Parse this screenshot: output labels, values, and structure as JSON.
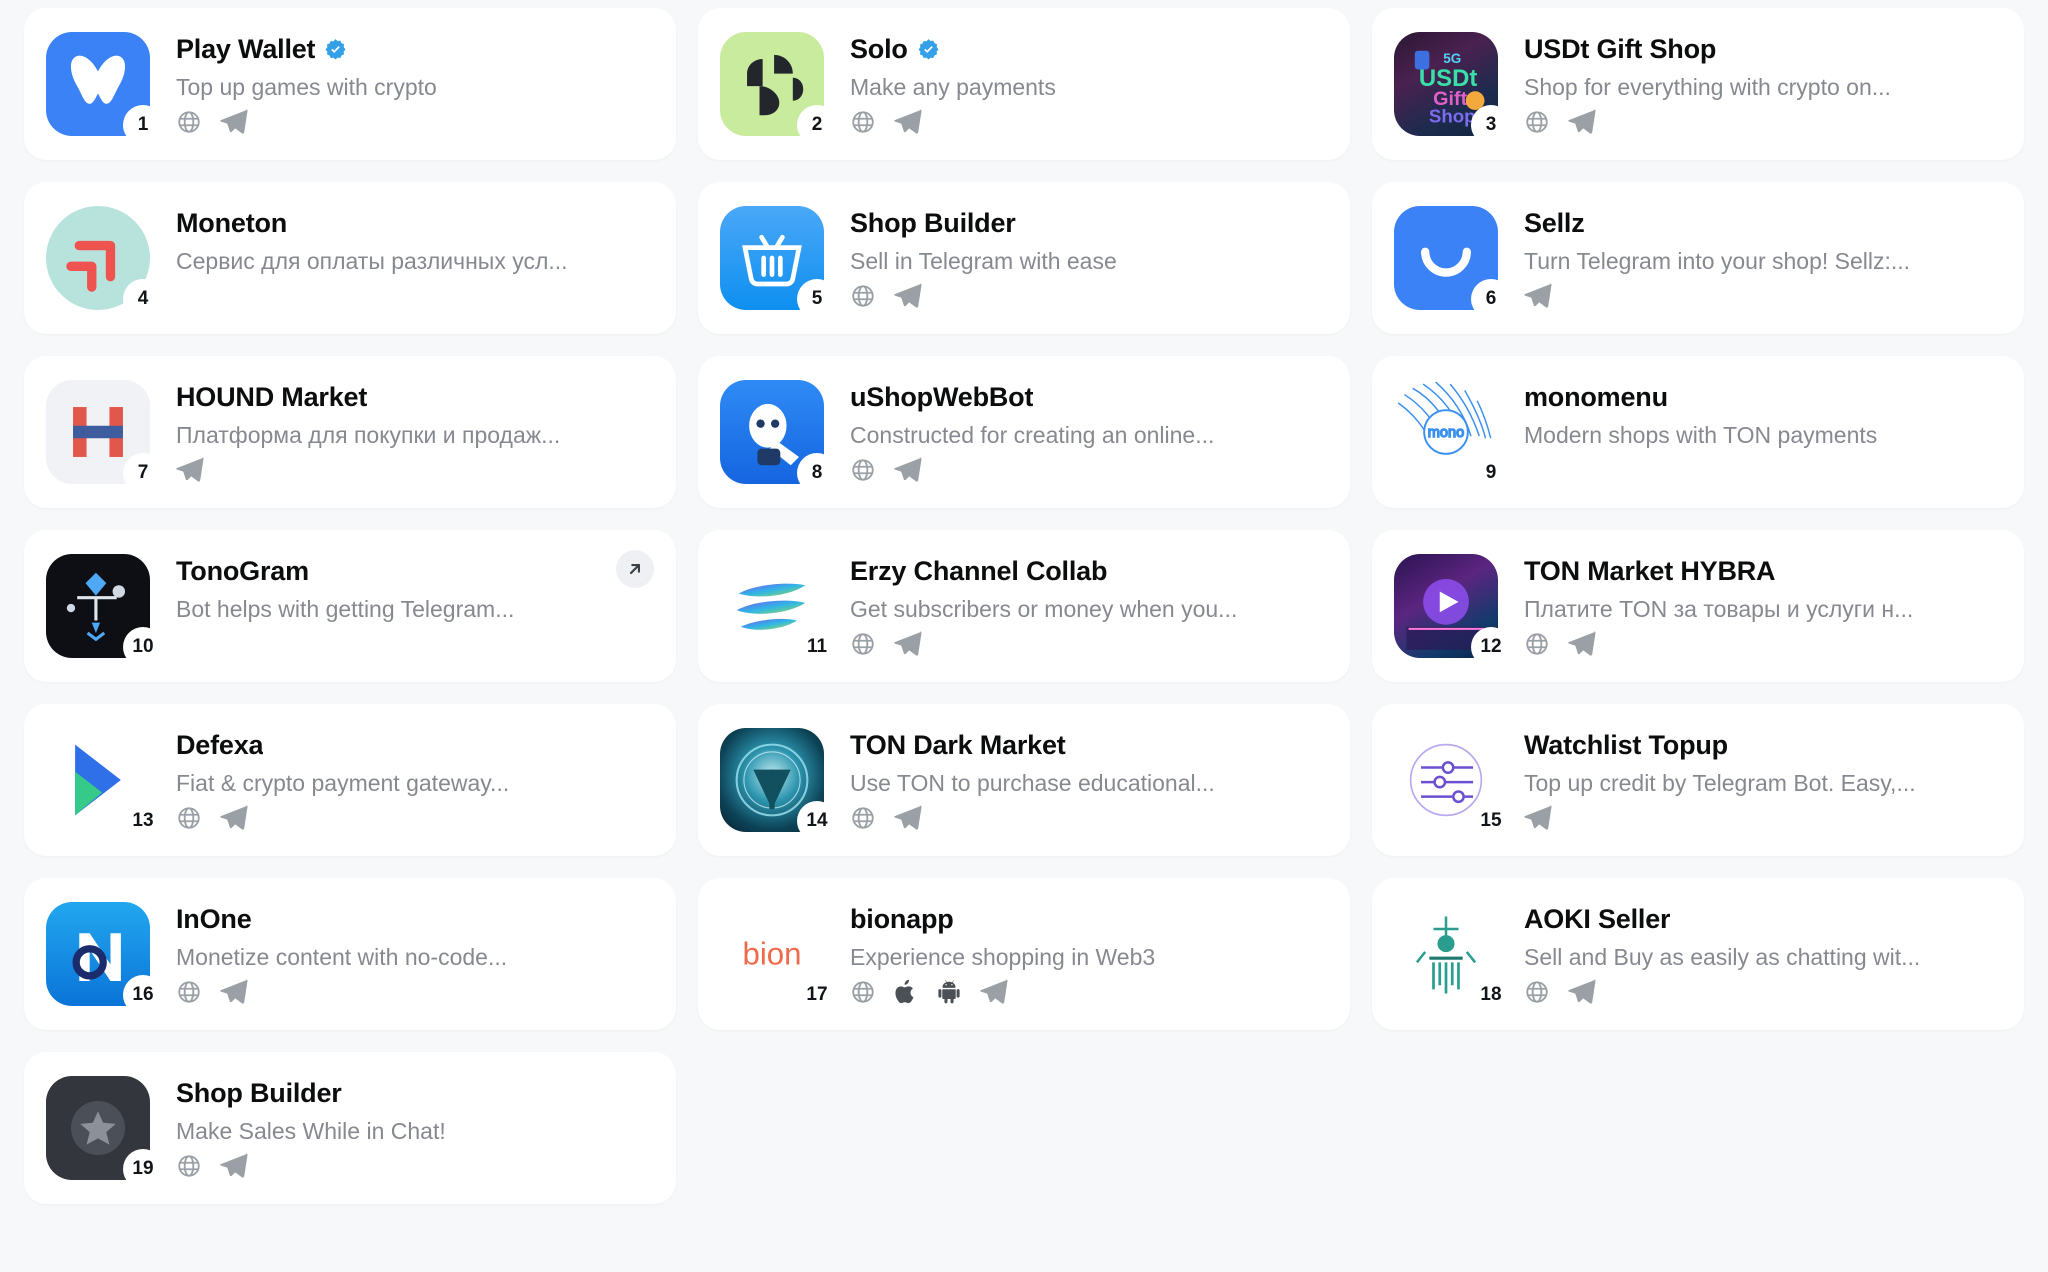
{
  "page": {
    "title": "App directory grid"
  },
  "icons": {
    "web": "globe-icon",
    "telegram": "telegram-icon",
    "apple": "apple-icon",
    "android": "android-icon",
    "verified": "verified-badge-icon",
    "external": "external-link-icon"
  },
  "colors": {
    "page_background": "#f7f8fa",
    "card_background": "#ffffff",
    "title": "#0c0d0e",
    "description": "#86898f",
    "verified": "#34a0e8",
    "accent_blue": "#3b82f6"
  },
  "cards": [
    {
      "rank": "1",
      "name": "Play Wallet",
      "description": "Top up games with crypto",
      "verified": true,
      "links": [
        "web",
        "telegram"
      ],
      "external_badge": false
    },
    {
      "rank": "2",
      "name": "Solo",
      "description": "Make any payments",
      "verified": true,
      "links": [
        "web",
        "telegram"
      ],
      "external_badge": false
    },
    {
      "rank": "3",
      "name": "USDt Gift Shop",
      "description": "Shop for everything with crypto on...",
      "verified": false,
      "links": [
        "web",
        "telegram"
      ],
      "external_badge": false
    },
    {
      "rank": "4",
      "name": "Moneton",
      "description": "Сервис для оплаты различных усл...",
      "verified": false,
      "links": [],
      "external_badge": false
    },
    {
      "rank": "5",
      "name": "Shop Builder",
      "description": "Sell in Telegram with ease",
      "verified": false,
      "links": [
        "web",
        "telegram"
      ],
      "external_badge": false
    },
    {
      "rank": "6",
      "name": "Sellz",
      "description": "Turn Telegram into your shop! Sellz:...",
      "verified": false,
      "links": [
        "telegram"
      ],
      "external_badge": false
    },
    {
      "rank": "7",
      "name": "HOUND Market",
      "description": "Платформа для покупки и продаж...",
      "verified": false,
      "links": [
        "telegram"
      ],
      "external_badge": false
    },
    {
      "rank": "8",
      "name": "uShopWebBot",
      "description": "Constructed for creating an online...",
      "verified": false,
      "links": [
        "web",
        "telegram"
      ],
      "external_badge": false
    },
    {
      "rank": "9",
      "name": "monomenu",
      "description": "Modern shops with TON payments",
      "verified": false,
      "links": [],
      "external_badge": false
    },
    {
      "rank": "10",
      "name": "TonoGram",
      "description": "Bot helps with getting Telegram...",
      "verified": false,
      "links": [],
      "external_badge": true
    },
    {
      "rank": "11",
      "name": "Erzy Channel Collab",
      "description": "Get subscribers or money when you...",
      "verified": false,
      "links": [
        "web",
        "telegram"
      ],
      "external_badge": false
    },
    {
      "rank": "12",
      "name": "TON Market HYBRA",
      "description": "Платите TON за товары и услуги н...",
      "verified": false,
      "links": [
        "web",
        "telegram"
      ],
      "external_badge": false
    },
    {
      "rank": "13",
      "name": "Defexa",
      "description": "Fiat & crypto payment gateway...",
      "verified": false,
      "links": [
        "web",
        "telegram"
      ],
      "external_badge": false
    },
    {
      "rank": "14",
      "name": "TON Dark Market",
      "description": "Use TON to purchase educational...",
      "verified": false,
      "links": [
        "web",
        "telegram"
      ],
      "external_badge": false
    },
    {
      "rank": "15",
      "name": "Watchlist Topup",
      "description": "Top up credit by Telegram Bot. Easy,...",
      "verified": false,
      "links": [
        "telegram"
      ],
      "external_badge": false
    },
    {
      "rank": "16",
      "name": "InOne",
      "description": "Monetize content with no-code...",
      "verified": false,
      "links": [
        "web",
        "telegram"
      ],
      "external_badge": false
    },
    {
      "rank": "17",
      "name": "bionapp",
      "description": "Experience shopping in Web3",
      "verified": false,
      "links": [
        "web",
        "apple",
        "android",
        "telegram"
      ],
      "external_badge": false
    },
    {
      "rank": "18",
      "name": "AOKI Seller",
      "description": "Sell and Buy as easily as chatting wit...",
      "verified": false,
      "links": [
        "web",
        "telegram"
      ],
      "external_badge": false
    },
    {
      "rank": "19",
      "name": "Shop Builder",
      "description": "Make Sales While in Chat!",
      "verified": false,
      "links": [
        "web",
        "telegram"
      ],
      "external_badge": false
    }
  ]
}
